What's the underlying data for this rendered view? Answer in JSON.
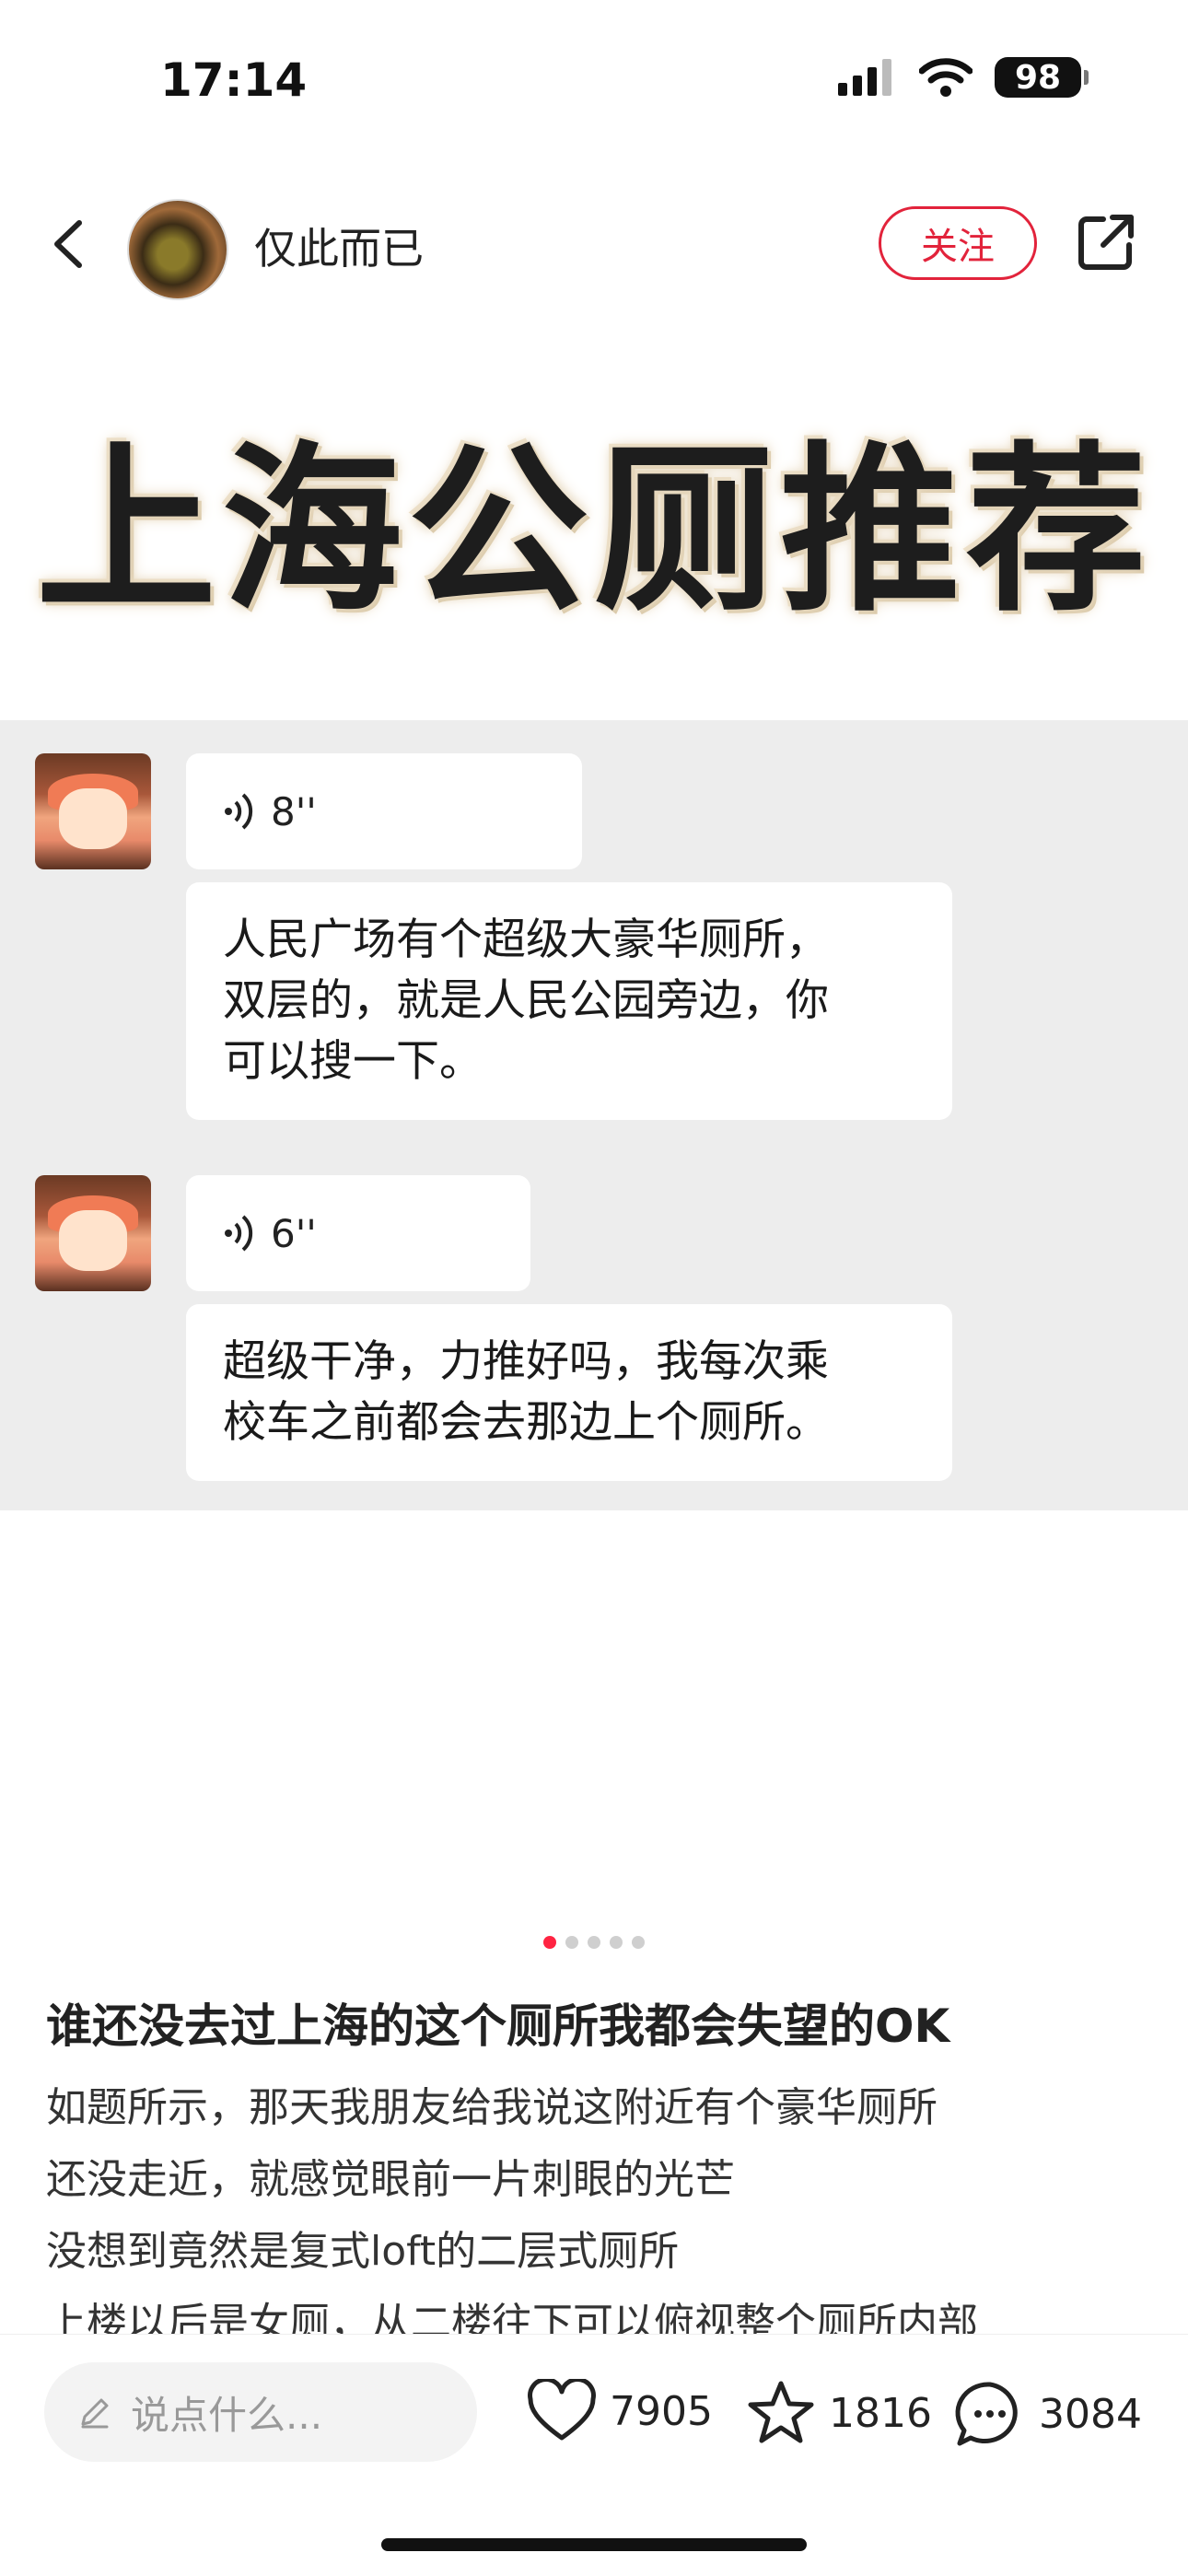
{
  "status_bar": {
    "time": "17:14",
    "battery": "98"
  },
  "header": {
    "author_name": "仅此而已",
    "follow_label": "关注"
  },
  "image": {
    "banner_title": "上海公厕推荐",
    "messages": [
      {
        "voice_duration": "8''",
        "text_lines": [
          "人民广场有个超级大豪华厕所，",
          "双层的，就是人民公园旁边，你",
          "可以搜一下。"
        ]
      },
      {
        "voice_duration": "6''",
        "text_lines": [
          "超级干净，力推好吗，我每次乘",
          "校车之前都会去那边上个厕所。"
        ]
      }
    ]
  },
  "pager": {
    "total": 5,
    "active": 1
  },
  "post": {
    "title": "谁还没去过上海的这个厕所我都会失望的OK",
    "lines": [
      "如题所示，那天我朋友给我说这附近有个豪华厕所",
      "还没走近，就感觉眼前一片刺眼的光芒",
      "没想到竟然是复式loft的二层式厕所",
      "上楼以后是女厕，从二楼往下可以俯视整个厕所内部"
    ]
  },
  "bottom_bar": {
    "comment_placeholder": "说点什么...",
    "likes": "7905",
    "stars": "1816",
    "comments": "3084"
  },
  "colors": {
    "accent": "#ff2442",
    "follow": "#e2233b",
    "chat_bg": "#ededed"
  }
}
